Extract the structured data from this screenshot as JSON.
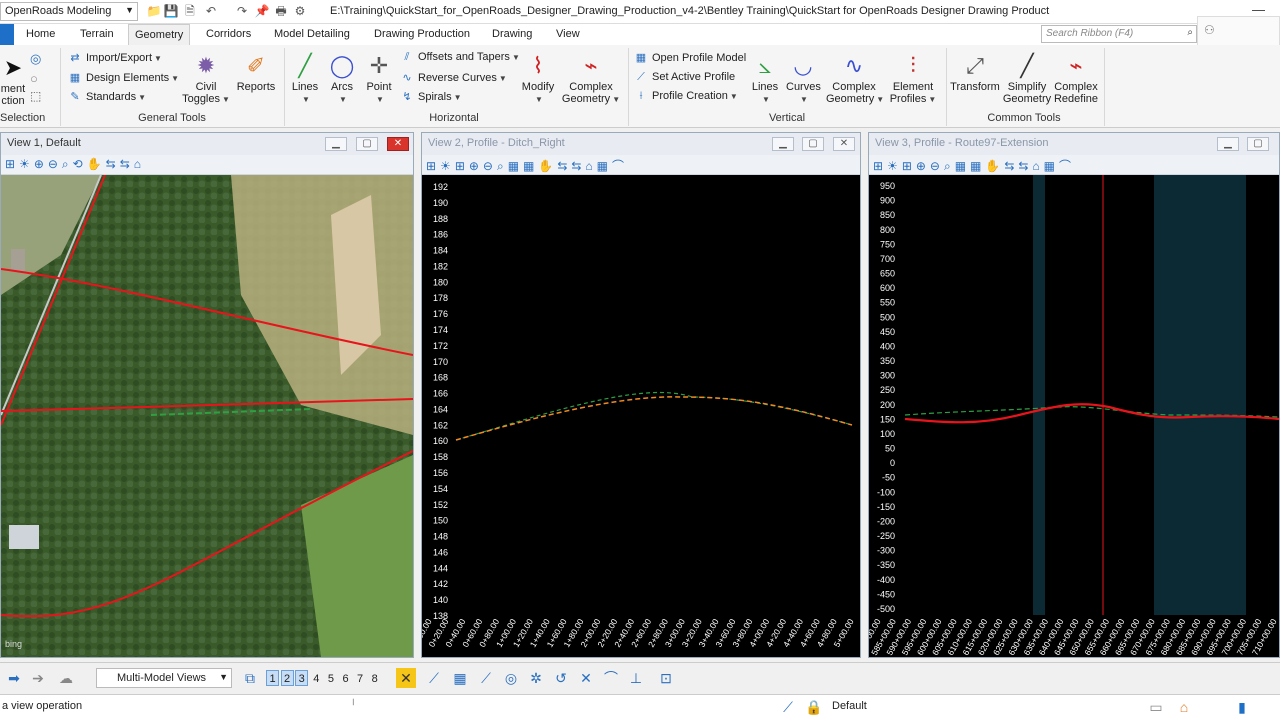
{
  "window": {
    "workflow": "OpenRoads Modeling",
    "title_path": "E:\\Training\\QuickStart_for_OpenRoads_Designer_Drawing_Production_v4-2\\Bentley Training\\QuickStart for OpenRoads Designer Drawing Production\\De..."
  },
  "tabs": [
    "Home",
    "Terrain",
    "Geometry",
    "Corridors",
    "Model Detailing",
    "Drawing Production",
    "Drawing",
    "View"
  ],
  "active_tab": "Geometry",
  "search": {
    "placeholder": "Search Ribbon (F4)"
  },
  "ribbon": {
    "selection": {
      "element_label_1": "ment",
      "element_label_2": "ction",
      "group_label": "Selection"
    },
    "general_tools": {
      "import_export": "Import/Export",
      "design_elements": "Design Elements",
      "standards": "Standards",
      "civil_toggles_1": "Civil",
      "civil_toggles_2": "Toggles",
      "reports": "Reports",
      "group_label": "General Tools"
    },
    "horizontal": {
      "lines": "Lines",
      "arcs": "Arcs",
      "point": "Point",
      "offsets_tapers": "Offsets and Tapers",
      "reverse_curves": "Reverse Curves",
      "spirals": "Spirals",
      "modify": "Modify",
      "complex_geometry_1": "Complex",
      "complex_geometry_2": "Geometry",
      "group_label": "Horizontal"
    },
    "vertical": {
      "open_profile_model": "Open Profile Model",
      "set_active_profile": "Set Active Profile",
      "profile_creation": "Profile Creation",
      "lines": "Lines",
      "curves": "Curves",
      "complex_geometry_1": "Complex",
      "complex_geometry_2": "Geometry",
      "element_profiles_1": "Element",
      "element_profiles_2": "Profiles",
      "group_label": "Vertical"
    },
    "common_tools": {
      "transform": "Transform",
      "simplify_1": "Simplify",
      "simplify_2": "Geometry",
      "complex_redefine_1": "Complex",
      "complex_redefine_2": "Redefine",
      "group_label": "Common Tools"
    }
  },
  "views": {
    "view1": {
      "title": "View 1, Default",
      "watermark": "bing"
    },
    "view2": {
      "title": "View 2, Profile - Ditch_Right",
      "y_ticks": [
        "192",
        "190",
        "188",
        "186",
        "184",
        "182",
        "180",
        "178",
        "176",
        "174",
        "172",
        "170",
        "168",
        "166",
        "164",
        "162",
        "160",
        "158",
        "156",
        "154",
        "152",
        "150",
        "148",
        "146",
        "144",
        "142",
        "140",
        "138"
      ],
      "x_ticks": [
        "0+00.00",
        "0+20.00",
        "0+40.00",
        "0+60.00",
        "0+80.00",
        "1+00.00",
        "1+20.00",
        "1+40.00",
        "1+60.00",
        "1+80.00",
        "2+00.00",
        "2+20.00",
        "2+40.00",
        "2+60.00",
        "2+80.00",
        "3+00.00",
        "3+20.00",
        "3+40.00",
        "3+60.00",
        "3+80.00",
        "4+00.00",
        "4+20.00",
        "4+40.00",
        "4+60.00",
        "4+80.00",
        "5+00.00"
      ]
    },
    "view3": {
      "title": "View 3, Profile - Route97-Extension",
      "y_ticks": [
        "950",
        "900",
        "850",
        "800",
        "750",
        "700",
        "650",
        "600",
        "550",
        "500",
        "450",
        "400",
        "350",
        "300",
        "250",
        "200",
        "150",
        "100",
        "50",
        "0",
        "-50",
        "-100",
        "-150",
        "-200",
        "-250",
        "-300",
        "-350",
        "-400",
        "-450",
        "-500"
      ],
      "x_ticks": [
        "580+00.00",
        "585+00.00",
        "590+00.00",
        "595+00.00",
        "600+00.00",
        "605+00.00",
        "610+00.00",
        "615+00.00",
        "620+00.00",
        "625+00.00",
        "630+00.00",
        "635+00.00",
        "640+00.00",
        "645+00.00",
        "650+00.00",
        "655+00.00",
        "660+00.00",
        "665+00.00",
        "670+00.00",
        "675+00.00",
        "680+00.00",
        "685+00.00",
        "690+00.00",
        "695+00.00",
        "700+00.00",
        "705+00.00",
        "710+00.00"
      ]
    }
  },
  "bottom": {
    "view_groups": "Multi-Model Views",
    "view_numbers": [
      "1",
      "2",
      "3",
      "4",
      "5",
      "6",
      "7",
      "8"
    ],
    "active_views": [
      "1",
      "2",
      "3"
    ]
  },
  "status": {
    "message": "a view operation",
    "active_level": "Default"
  },
  "colors": {
    "accent": "#1e6fc7",
    "profile_red": "#e8141c",
    "profile_orange": "#f08a24",
    "existing_green": "#2ea043"
  }
}
